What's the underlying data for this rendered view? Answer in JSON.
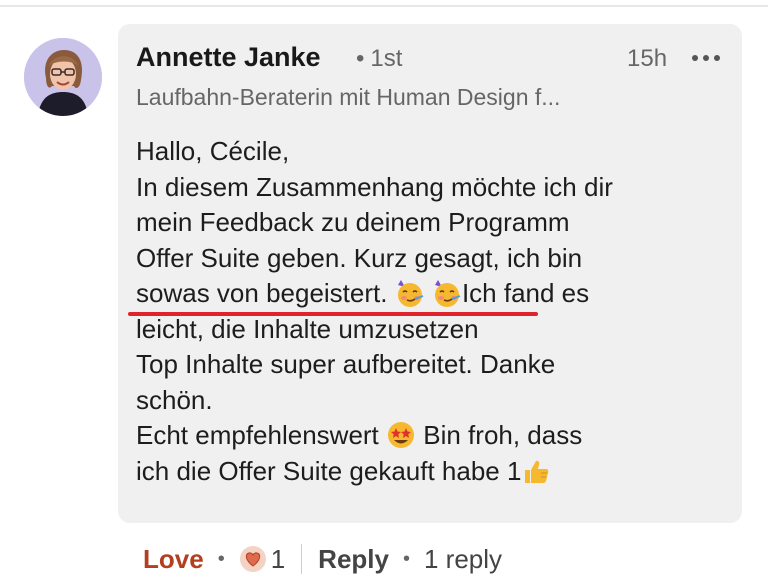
{
  "comment": {
    "author": "Annette Janke",
    "degree_separator": "•",
    "degree": "1st",
    "time": "15h",
    "headline": "Laufbahn-Beraterin mit Human Design f...",
    "body": {
      "line1": "Hallo, Cécile,",
      "line2": "In diesem Zusammenhang möchte ich dir",
      "line3": "mein Feedback zu deinem Programm",
      "line4": "Offer Suite geben. Kurz gesagt,  ich bin",
      "line5a": "sowas von begeistert.",
      "line5b": "Ich fand es",
      "line6": "leicht, die Inhalte umzusetzen",
      "line7": "Top Inhalte super aufbereitet. Danke",
      "line8": "schön.",
      "line9a": "Echt empfehlenswert",
      "line9b": " Bin froh,  dass",
      "line10a": "ich die Offer Suite gekauft habe 1"
    },
    "emojis": [
      "partying-face-emoji",
      "partying-face-emoji",
      "star-struck-emoji",
      "thumbs-up-emoji"
    ],
    "highlight_color": "#e0222a"
  },
  "actions": {
    "love_label": "Love",
    "reaction_count": "1",
    "reply_label": "Reply",
    "dot": "•",
    "replies_label": "1 reply"
  }
}
